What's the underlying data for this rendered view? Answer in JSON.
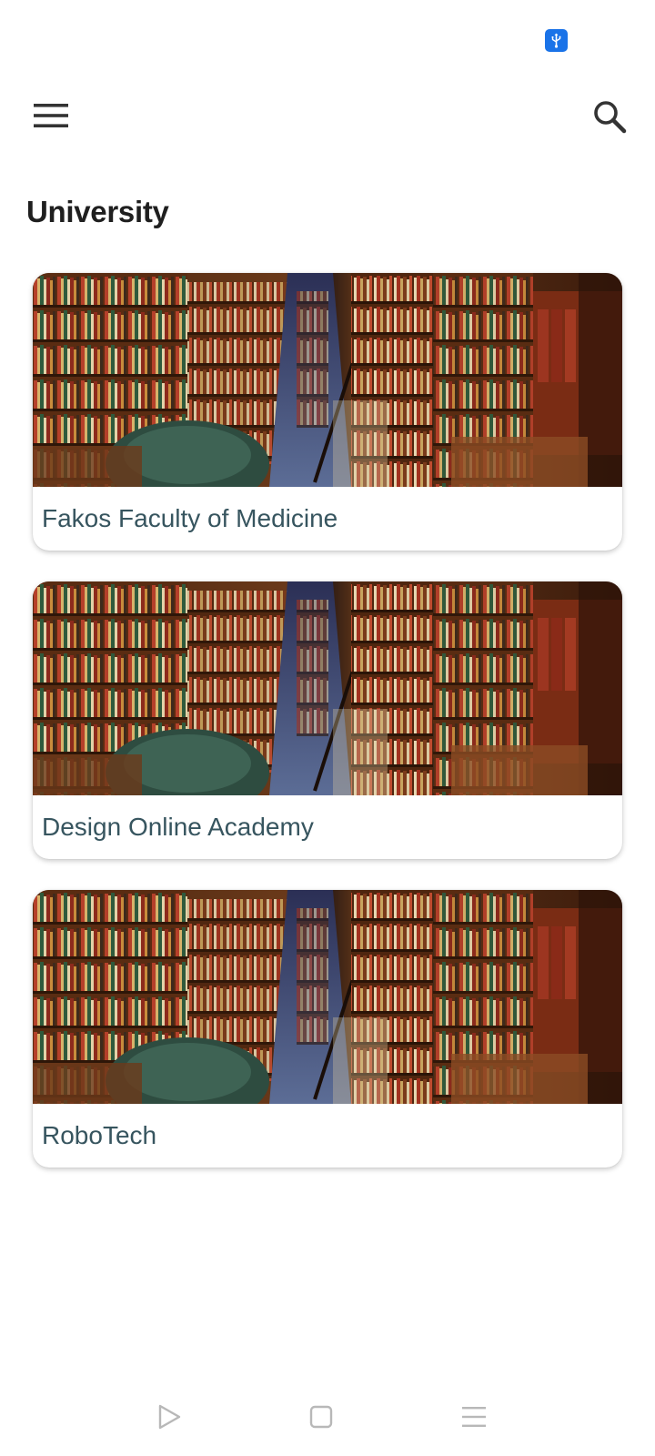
{
  "status_bar": {
    "icons": [
      "usb-icon"
    ],
    "usb_badge_color": "#1a73e8"
  },
  "app_bar": {
    "menu_icon": "hamburger-menu-icon",
    "search_icon": "search-icon"
  },
  "page": {
    "title": "University"
  },
  "cards": [
    {
      "name": "Fakos Faculty of Medicine",
      "image": "library-bookshelves-image"
    },
    {
      "name": "Design Online Academy",
      "image": "library-bookshelves-image"
    },
    {
      "name": "RoboTech",
      "image": "library-bookshelves-image"
    }
  ],
  "nav_bar": {
    "buttons": [
      "back-triangle-icon",
      "home-square-icon",
      "recents-menu-icon"
    ]
  },
  "colors": {
    "title": "#1f1f1f",
    "card_label": "#37555f",
    "icon": "#333333",
    "nav_icon": "#b8b8b8"
  }
}
